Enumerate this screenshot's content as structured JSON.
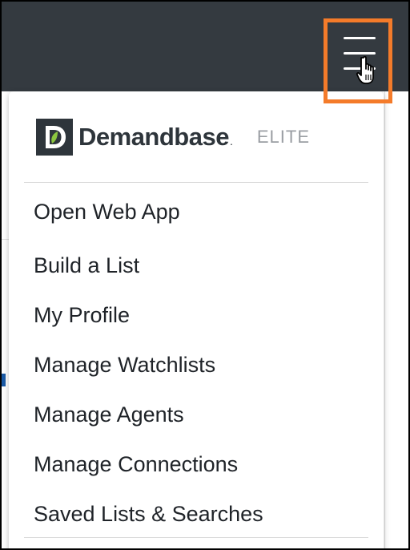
{
  "header": {
    "menu_icon": "hamburger-menu-icon",
    "cursor_icon": "hand-pointer-cursor-icon",
    "highlight_color": "#f47b2a",
    "bar_color": "#343a40"
  },
  "dropdown": {
    "logo_text": "Demandbase",
    "logo_trademark": ".",
    "tier": "ELITE",
    "logo_color": "#2e353b",
    "logo_accent": "#8cc63f",
    "items": [
      {
        "label": "Open Web App"
      },
      {
        "label": "Build a List"
      },
      {
        "label": "My Profile"
      },
      {
        "label": "Manage Watchlists"
      },
      {
        "label": "Manage Agents"
      },
      {
        "label": "Manage Connections"
      },
      {
        "label": "Saved Lists & Searches"
      }
    ]
  }
}
